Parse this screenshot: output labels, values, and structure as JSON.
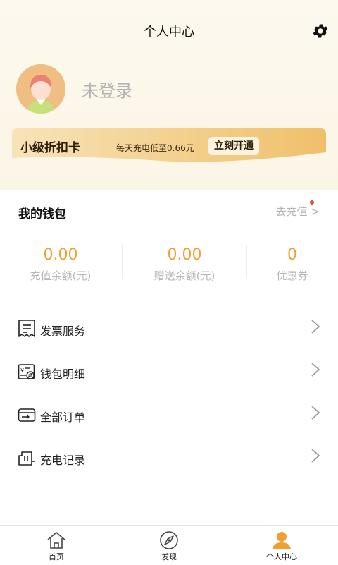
{
  "header": {
    "title": "个人中心",
    "settings_icon": "gear-icon"
  },
  "profile": {
    "login_text": "未登录",
    "avatar_icon": "avatar-icon"
  },
  "vip": {
    "title": "小级折扣卡",
    "description": "每天充电低至0.66元",
    "button_label": "立刻开通"
  },
  "wallet": {
    "title": "我的钱包",
    "recharge_label": "去充值 >",
    "stats": [
      {
        "value": "0.00",
        "label": "充值余额(元)"
      },
      {
        "value": "0.00",
        "label": "赠送余额(元)"
      },
      {
        "value": "0",
        "label": "优惠券"
      }
    ]
  },
  "menu": [
    {
      "label": "发票服务",
      "icon": "invoice-icon"
    },
    {
      "label": "钱包明细",
      "icon": "wallet-detail-icon"
    },
    {
      "label": "全部订单",
      "icon": "orders-icon"
    },
    {
      "label": "充电记录",
      "icon": "charging-record-icon"
    }
  ],
  "tabbar": [
    {
      "label": "首页",
      "icon": "home-icon"
    },
    {
      "label": "发现",
      "icon": "compass-icon"
    },
    {
      "label": "个人中心",
      "icon": "profile-icon",
      "active": true
    }
  ],
  "colors": {
    "accent": "#f0a032",
    "active_tab": "#f0a032",
    "vip_gold": "#f0c36e"
  }
}
